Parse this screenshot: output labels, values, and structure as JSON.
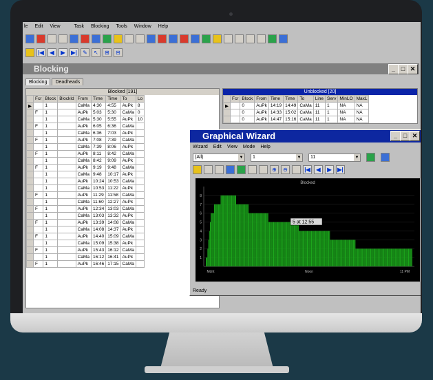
{
  "menu": [
    "le",
    "Edit",
    "View",
    "Task",
    "Blocking",
    "Tools",
    "Window",
    "Help"
  ],
  "blocking_window": {
    "title": "Blocking",
    "tabs": [
      "Blocking",
      "Deadheads"
    ],
    "blocked_caption": "Blocked [191]",
    "blocked_columns": [
      "Fcr",
      "Block",
      "BlockId",
      "From",
      "Time",
      "Time",
      "To",
      "Lo"
    ],
    "blocked_rows": [
      [
        "",
        "1",
        "",
        "CaMa",
        "4:30",
        "4:55",
        "AuPk",
        "8"
      ],
      [
        "F",
        "1",
        "",
        "AuPk",
        "5:03",
        "5:30",
        "CaMa",
        "0"
      ],
      [
        "",
        "1",
        "",
        "CaMa",
        "5:30",
        "5:55",
        "AuPk",
        "10"
      ],
      [
        "F",
        "1",
        "",
        "AuPk",
        "6:05",
        "6:36",
        "CaMa",
        ""
      ],
      [
        "",
        "1",
        "",
        "CaMa",
        "6:36",
        "7:03",
        "AuPk",
        ""
      ],
      [
        "F",
        "1",
        "",
        "AuPk",
        "7:08",
        "7:39",
        "CaMa",
        ""
      ],
      [
        "",
        "1",
        "",
        "CaMa",
        "7:39",
        "8:06",
        "AuPk",
        ""
      ],
      [
        "F",
        "1",
        "",
        "AuPk",
        "8:11",
        "8:42",
        "CaMa",
        ""
      ],
      [
        "",
        "1",
        "",
        "CaMa",
        "8:42",
        "9:09",
        "AuPk",
        ""
      ],
      [
        "F",
        "1",
        "",
        "AuPk",
        "9:19",
        "9:48",
        "CaMa",
        ""
      ],
      [
        "",
        "1",
        "",
        "CaMa",
        "9:48",
        "10:17",
        "AuPk",
        ""
      ],
      [
        "",
        "1",
        "",
        "AuPk",
        "10:24",
        "10:53",
        "CaMa",
        ""
      ],
      [
        "",
        "1",
        "",
        "CaMa",
        "10:53",
        "11:22",
        "AuPk",
        ""
      ],
      [
        "F",
        "1",
        "",
        "AuPk",
        "11:29",
        "11:58",
        "CaMa",
        ""
      ],
      [
        "",
        "1",
        "",
        "CaMa",
        "11:60",
        "12:27",
        "AuPk",
        ""
      ],
      [
        "F",
        "1",
        "",
        "AuPk",
        "12:34",
        "13:03",
        "CaMa",
        ""
      ],
      [
        "",
        "1",
        "",
        "CaMa",
        "13:03",
        "13:32",
        "AuPk",
        ""
      ],
      [
        "F",
        "1",
        "",
        "AuPk",
        "13:39",
        "14:08",
        "CaMa",
        ""
      ],
      [
        "",
        "1",
        "",
        "CaMa",
        "14:08",
        "14:37",
        "AuPk",
        ""
      ],
      [
        "F",
        "1",
        "",
        "AuPk",
        "14:40",
        "15:09",
        "CaMa",
        ""
      ],
      [
        "",
        "1",
        "",
        "CaMa",
        "15:09",
        "15:38",
        "AuPk",
        ""
      ],
      [
        "F",
        "1",
        "",
        "AuPk",
        "15:43",
        "16:12",
        "CaMa",
        ""
      ],
      [
        "",
        "1",
        "",
        "CaMa",
        "16:12",
        "16:41",
        "AuPk",
        ""
      ],
      [
        "F",
        "1",
        "",
        "AuPk",
        "16:46",
        "17:15",
        "CaMa",
        ""
      ]
    ],
    "unblocked_caption": "Unblocked [20]",
    "unblocked_columns": [
      "Fcr",
      "Block",
      "From",
      "Time",
      "Time",
      "To",
      "Line",
      "Serv",
      "MinLO",
      "MaxL"
    ],
    "unblocked_rows": [
      [
        "",
        "0",
        "AuPk",
        "14:19",
        "14:49",
        "CaMa",
        "11",
        "1",
        "NA",
        "NA"
      ],
      [
        "",
        "0",
        "AuPk",
        "14:33",
        "15:02",
        "CaMa",
        "11",
        "1",
        "NA",
        "NA"
      ],
      [
        "",
        "0",
        "AuPk",
        "14:47",
        "15:16",
        "CaMa",
        "11",
        "1",
        "NA",
        "NA"
      ]
    ]
  },
  "wizard": {
    "title": "Graphical Wizard",
    "menu": [
      "Wizard",
      "Edit",
      "View",
      "Mode",
      "Help"
    ],
    "combo1": "(All)",
    "combo2": "1",
    "combo3": "11",
    "chart_title": "Blocked",
    "tooltip": "5 at 12:55",
    "xlabels": [
      "Mdnt",
      "Noon",
      "11 PM"
    ],
    "status": "Ready"
  },
  "chart_data": {
    "type": "bar",
    "title": "Blocked",
    "ylim": [
      0,
      9
    ],
    "yticks": [
      "1",
      "2",
      "3",
      "4",
      "5",
      "6",
      "7",
      "8"
    ],
    "x": [
      40,
      41,
      42,
      43,
      44,
      45,
      46,
      47,
      48,
      49,
      50,
      51,
      52,
      53,
      54,
      55,
      56,
      57,
      58,
      59,
      60,
      61,
      62,
      63,
      64,
      65,
      66,
      67,
      68,
      69,
      70,
      71,
      72,
      73,
      74,
      75,
      76,
      77,
      78,
      79,
      80,
      81,
      82,
      83,
      84,
      85,
      86,
      87,
      88,
      89,
      90,
      91,
      92,
      93,
      94,
      95,
      96,
      97,
      98,
      99,
      100,
      101,
      102,
      103,
      104,
      105,
      106,
      107,
      108,
      109,
      110,
      111,
      112,
      113,
      114,
      115,
      116,
      117,
      118,
      119,
      120,
      121,
      122,
      123,
      124,
      125,
      126,
      127,
      128,
      129,
      130,
      131,
      132,
      133,
      134,
      135,
      136,
      137,
      138,
      139,
      140,
      141,
      142,
      143,
      144,
      145,
      146,
      147,
      148,
      149,
      150,
      151,
      152,
      153,
      154,
      155,
      156,
      157,
      158,
      159,
      160,
      161,
      162,
      163,
      164,
      165,
      166,
      167,
      168,
      169,
      170,
      171,
      172,
      173,
      174,
      175,
      176,
      177,
      178,
      179,
      180,
      181,
      182,
      183,
      184,
      185,
      186,
      187,
      188,
      189,
      190,
      191,
      192,
      193,
      194,
      195,
      196,
      197,
      198,
      199,
      200,
      201,
      202,
      203,
      204,
      205,
      206,
      207,
      208,
      209,
      210,
      211,
      212,
      213,
      214,
      215,
      216,
      217,
      218,
      219,
      220,
      221,
      222,
      223,
      224,
      225,
      226,
      227,
      228,
      229,
      230,
      231,
      232,
      233,
      234,
      235,
      236,
      237,
      238,
      239,
      240,
      241,
      242,
      243,
      244,
      245,
      246,
      247,
      248,
      249,
      250,
      251,
      252,
      253,
      254,
      255,
      256,
      257,
      258,
      259,
      260,
      261,
      262,
      263,
      264,
      265,
      266,
      267,
      268,
      269,
      270,
      271,
      272,
      273,
      274,
      275,
      276,
      277,
      278,
      279,
      280
    ],
    "values": [
      1,
      1,
      2,
      3,
      4,
      5,
      6,
      6,
      6,
      6,
      7,
      7,
      7,
      7,
      7,
      7,
      7,
      7,
      8,
      8,
      8,
      8,
      8,
      8,
      8,
      8,
      8,
      8,
      8,
      8,
      8,
      8,
      8,
      8,
      8,
      8,
      8,
      7,
      7,
      7,
      7,
      7,
      7,
      7,
      7,
      7,
      7,
      7,
      7,
      7,
      7,
      7,
      6,
      6,
      6,
      6,
      6,
      6,
      6,
      6,
      6,
      6,
      6,
      6,
      6,
      6,
      6,
      6,
      6,
      6,
      6,
      6,
      6,
      6,
      6,
      6,
      5,
      5,
      5,
      5,
      5,
      5,
      5,
      5,
      5,
      5,
      5,
      5,
      5,
      5,
      5,
      5,
      5,
      5,
      5,
      5,
      5,
      5,
      5,
      5,
      5,
      5,
      5,
      5,
      5,
      5,
      5,
      5,
      5,
      5,
      5,
      5,
      5,
      4,
      4,
      4,
      4,
      4,
      4,
      4,
      4,
      4,
      4,
      4,
      4,
      4,
      4,
      4,
      4,
      4,
      4,
      4,
      4,
      4,
      4,
      4,
      4,
      4,
      4,
      4,
      4,
      4,
      4,
      4,
      4,
      4,
      4,
      4,
      4,
      4,
      4,
      3,
      3,
      3,
      3,
      3,
      3,
      3,
      3,
      3,
      3,
      3,
      3,
      3,
      3,
      3,
      3,
      3,
      3,
      3,
      3,
      3,
      3,
      3,
      3,
      3,
      3,
      3,
      3,
      3,
      3,
      3,
      2,
      2,
      2,
      2,
      2,
      2,
      2,
      2,
      2,
      2,
      2,
      2,
      2,
      2,
      2,
      2,
      2,
      2,
      2,
      2,
      2,
      2,
      2,
      2,
      2,
      2,
      2,
      2,
      2,
      2,
      2,
      2,
      2,
      2,
      2,
      2,
      2,
      2,
      2,
      2,
      2,
      2,
      2,
      2,
      2,
      2,
      2,
      2,
      2,
      2,
      2,
      2,
      2,
      2,
      2,
      2,
      2,
      2,
      2,
      2,
      2,
      2,
      2,
      2,
      2,
      2,
      2,
      2,
      2
    ],
    "color": "#1ca81c"
  }
}
